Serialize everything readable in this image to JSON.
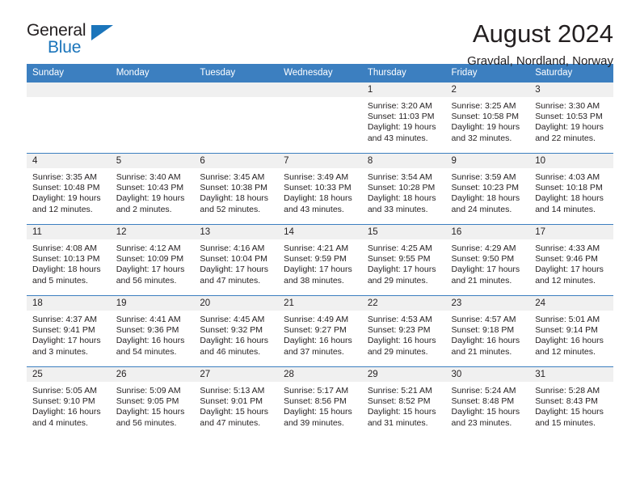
{
  "logo": {
    "word_one": "General",
    "word_two": "Blue",
    "triangle_icon": "triangle-icon"
  },
  "header": {
    "title": "August 2024",
    "subtitle": "Gravdal, Nordland, Norway"
  },
  "theme": {
    "accent": "#3c7fc0",
    "logo_blue": "#1b75bb",
    "daynum_band": "#f0f0f0",
    "text": "#231f20"
  },
  "calendar": {
    "weekday_headers": [
      "Sunday",
      "Monday",
      "Tuesday",
      "Wednesday",
      "Thursday",
      "Friday",
      "Saturday"
    ],
    "weeks": [
      [
        {
          "day": "",
          "lines": []
        },
        {
          "day": "",
          "lines": []
        },
        {
          "day": "",
          "lines": []
        },
        {
          "day": "",
          "lines": []
        },
        {
          "day": "1",
          "lines": [
            "Sunrise: 3:20 AM",
            "Sunset: 11:03 PM",
            "Daylight: 19 hours",
            "and 43 minutes."
          ]
        },
        {
          "day": "2",
          "lines": [
            "Sunrise: 3:25 AM",
            "Sunset: 10:58 PM",
            "Daylight: 19 hours",
            "and 32 minutes."
          ]
        },
        {
          "day": "3",
          "lines": [
            "Sunrise: 3:30 AM",
            "Sunset: 10:53 PM",
            "Daylight: 19 hours",
            "and 22 minutes."
          ]
        }
      ],
      [
        {
          "day": "4",
          "lines": [
            "Sunrise: 3:35 AM",
            "Sunset: 10:48 PM",
            "Daylight: 19 hours",
            "and 12 minutes."
          ]
        },
        {
          "day": "5",
          "lines": [
            "Sunrise: 3:40 AM",
            "Sunset: 10:43 PM",
            "Daylight: 19 hours",
            "and 2 minutes."
          ]
        },
        {
          "day": "6",
          "lines": [
            "Sunrise: 3:45 AM",
            "Sunset: 10:38 PM",
            "Daylight: 18 hours",
            "and 52 minutes."
          ]
        },
        {
          "day": "7",
          "lines": [
            "Sunrise: 3:49 AM",
            "Sunset: 10:33 PM",
            "Daylight: 18 hours",
            "and 43 minutes."
          ]
        },
        {
          "day": "8",
          "lines": [
            "Sunrise: 3:54 AM",
            "Sunset: 10:28 PM",
            "Daylight: 18 hours",
            "and 33 minutes."
          ]
        },
        {
          "day": "9",
          "lines": [
            "Sunrise: 3:59 AM",
            "Sunset: 10:23 PM",
            "Daylight: 18 hours",
            "and 24 minutes."
          ]
        },
        {
          "day": "10",
          "lines": [
            "Sunrise: 4:03 AM",
            "Sunset: 10:18 PM",
            "Daylight: 18 hours",
            "and 14 minutes."
          ]
        }
      ],
      [
        {
          "day": "11",
          "lines": [
            "Sunrise: 4:08 AM",
            "Sunset: 10:13 PM",
            "Daylight: 18 hours",
            "and 5 minutes."
          ]
        },
        {
          "day": "12",
          "lines": [
            "Sunrise: 4:12 AM",
            "Sunset: 10:09 PM",
            "Daylight: 17 hours",
            "and 56 minutes."
          ]
        },
        {
          "day": "13",
          "lines": [
            "Sunrise: 4:16 AM",
            "Sunset: 10:04 PM",
            "Daylight: 17 hours",
            "and 47 minutes."
          ]
        },
        {
          "day": "14",
          "lines": [
            "Sunrise: 4:21 AM",
            "Sunset: 9:59 PM",
            "Daylight: 17 hours",
            "and 38 minutes."
          ]
        },
        {
          "day": "15",
          "lines": [
            "Sunrise: 4:25 AM",
            "Sunset: 9:55 PM",
            "Daylight: 17 hours",
            "and 29 minutes."
          ]
        },
        {
          "day": "16",
          "lines": [
            "Sunrise: 4:29 AM",
            "Sunset: 9:50 PM",
            "Daylight: 17 hours",
            "and 21 minutes."
          ]
        },
        {
          "day": "17",
          "lines": [
            "Sunrise: 4:33 AM",
            "Sunset: 9:46 PM",
            "Daylight: 17 hours",
            "and 12 minutes."
          ]
        }
      ],
      [
        {
          "day": "18",
          "lines": [
            "Sunrise: 4:37 AM",
            "Sunset: 9:41 PM",
            "Daylight: 17 hours",
            "and 3 minutes."
          ]
        },
        {
          "day": "19",
          "lines": [
            "Sunrise: 4:41 AM",
            "Sunset: 9:36 PM",
            "Daylight: 16 hours",
            "and 54 minutes."
          ]
        },
        {
          "day": "20",
          "lines": [
            "Sunrise: 4:45 AM",
            "Sunset: 9:32 PM",
            "Daylight: 16 hours",
            "and 46 minutes."
          ]
        },
        {
          "day": "21",
          "lines": [
            "Sunrise: 4:49 AM",
            "Sunset: 9:27 PM",
            "Daylight: 16 hours",
            "and 37 minutes."
          ]
        },
        {
          "day": "22",
          "lines": [
            "Sunrise: 4:53 AM",
            "Sunset: 9:23 PM",
            "Daylight: 16 hours",
            "and 29 minutes."
          ]
        },
        {
          "day": "23",
          "lines": [
            "Sunrise: 4:57 AM",
            "Sunset: 9:18 PM",
            "Daylight: 16 hours",
            "and 21 minutes."
          ]
        },
        {
          "day": "24",
          "lines": [
            "Sunrise: 5:01 AM",
            "Sunset: 9:14 PM",
            "Daylight: 16 hours",
            "and 12 minutes."
          ]
        }
      ],
      [
        {
          "day": "25",
          "lines": [
            "Sunrise: 5:05 AM",
            "Sunset: 9:10 PM",
            "Daylight: 16 hours",
            "and 4 minutes."
          ]
        },
        {
          "day": "26",
          "lines": [
            "Sunrise: 5:09 AM",
            "Sunset: 9:05 PM",
            "Daylight: 15 hours",
            "and 56 minutes."
          ]
        },
        {
          "day": "27",
          "lines": [
            "Sunrise: 5:13 AM",
            "Sunset: 9:01 PM",
            "Daylight: 15 hours",
            "and 47 minutes."
          ]
        },
        {
          "day": "28",
          "lines": [
            "Sunrise: 5:17 AM",
            "Sunset: 8:56 PM",
            "Daylight: 15 hours",
            "and 39 minutes."
          ]
        },
        {
          "day": "29",
          "lines": [
            "Sunrise: 5:21 AM",
            "Sunset: 8:52 PM",
            "Daylight: 15 hours",
            "and 31 minutes."
          ]
        },
        {
          "day": "30",
          "lines": [
            "Sunrise: 5:24 AM",
            "Sunset: 8:48 PM",
            "Daylight: 15 hours",
            "and 23 minutes."
          ]
        },
        {
          "day": "31",
          "lines": [
            "Sunrise: 5:28 AM",
            "Sunset: 8:43 PM",
            "Daylight: 15 hours",
            "and 15 minutes."
          ]
        }
      ]
    ]
  }
}
